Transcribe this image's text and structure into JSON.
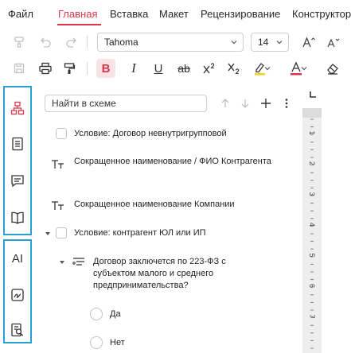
{
  "menu": {
    "items": [
      "Файл",
      "Главная",
      "Вставка",
      "Макет",
      "Рецензирование",
      "Конструктор"
    ],
    "active_index": 1
  },
  "toolbar": {
    "font_name": "Tahoma",
    "font_size": "14",
    "icons_row1": [
      "undo-icon",
      "redo-icon",
      "font-select",
      "font-size-select",
      "increase-font-icon",
      "decrease-font-icon"
    ],
    "icons_row2": [
      "save-icon",
      "print-icon",
      "format-painter-icon",
      "bold-icon",
      "italic-icon",
      "underline-icon",
      "strikethrough-icon",
      "superscript-icon",
      "subscript-icon",
      "highlight-icon",
      "font-color-icon",
      "eraser-icon"
    ],
    "bold": "B",
    "italic": "I",
    "underline": "U",
    "strike": "ab"
  },
  "colors": {
    "accent": "#d6374d",
    "sidebar_border": "#2a9fd6",
    "highlight_yellow": "#f2d21b",
    "font_red": "#d6374d"
  },
  "sidebar": {
    "group1": [
      "schema-icon",
      "document-icon",
      "comment-icon",
      "book-icon"
    ],
    "group2": [
      "ai-icon",
      "signature-icon",
      "document-search-icon"
    ],
    "ai_label": "AI"
  },
  "tree": {
    "search_placeholder": "Найти в схеме",
    "items": [
      {
        "kind": "checkbox",
        "text": "Условие: Договор невнутригрупповой"
      },
      {
        "kind": "text-field",
        "text": "Сокращенное наименование / ФИО Контрагента"
      },
      {
        "kind": "text-field",
        "text": "Сокращенное наименование Компании"
      },
      {
        "kind": "checkbox-expand",
        "text": "Условие: контрагент ЮЛ или ИП"
      },
      {
        "kind": "choice",
        "text": "Договор заключется по 223-ФЗ с субъектом малого и среднего предпринимательства?"
      },
      {
        "kind": "radio",
        "text": "Да"
      },
      {
        "kind": "radio",
        "text": "Нет"
      }
    ]
  },
  "ruler": {
    "numbers": [
      "1",
      "2",
      "3",
      "4",
      "5",
      "6",
      "7"
    ]
  }
}
